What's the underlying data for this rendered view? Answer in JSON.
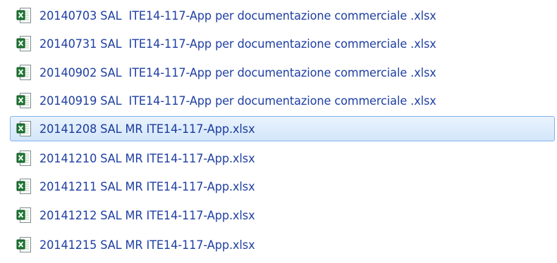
{
  "file_list": {
    "items": [
      {
        "name": "20140703 SAL  ITE14-117-App per documentazione commerciale .xlsx",
        "icon": "excel-file-icon",
        "selected": false
      },
      {
        "name": "20140731 SAL  ITE14-117-App per documentazione commerciale .xlsx",
        "icon": "excel-file-icon",
        "selected": false
      },
      {
        "name": "20140902 SAL  ITE14-117-App per documentazione commerciale .xlsx",
        "icon": "excel-file-icon",
        "selected": false
      },
      {
        "name": "20140919 SAL  ITE14-117-App per documentazione commerciale .xlsx",
        "icon": "excel-file-icon",
        "selected": false
      },
      {
        "name": "20141208 SAL MR ITE14-117-App.xlsx",
        "icon": "excel-file-icon",
        "selected": true
      },
      {
        "name": "20141210 SAL MR ITE14-117-App.xlsx",
        "icon": "excel-file-icon",
        "selected": false
      },
      {
        "name": "20141211 SAL MR ITE14-117-App.xlsx",
        "icon": "excel-file-icon",
        "selected": false
      },
      {
        "name": "20141212 SAL MR ITE14-117-App.xlsx",
        "icon": "excel-file-icon",
        "selected": false
      },
      {
        "name": "20141215 SAL MR ITE14-117-App.xlsx",
        "icon": "excel-file-icon",
        "selected": false
      }
    ]
  },
  "colors": {
    "link_text": "#1f3fa2",
    "selection_fill": "#d9eafc",
    "selection_border": "#82b4ec",
    "excel_green": "#1e7a34"
  }
}
